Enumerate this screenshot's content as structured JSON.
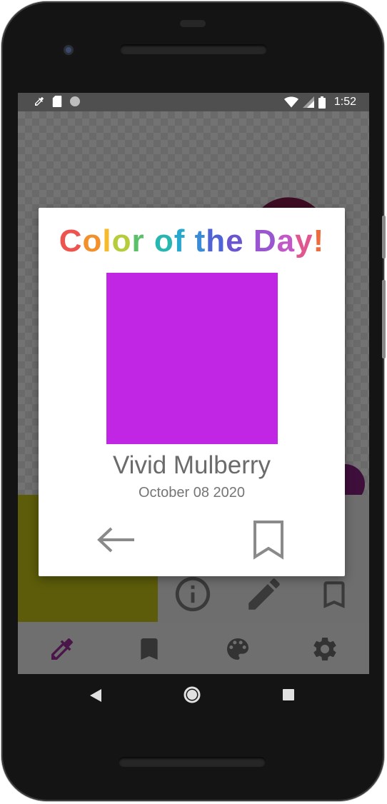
{
  "status_bar": {
    "time": "1:52",
    "left_icons": [
      "eyedropper-icon",
      "sd-card-icon",
      "circle-icon"
    ],
    "right_icons": [
      "wifi-icon",
      "signal-icon",
      "battery-icon"
    ]
  },
  "dialog": {
    "title_letters": [
      "C",
      "o",
      "l",
      "o",
      "r",
      " ",
      "o",
      "f",
      " ",
      "t",
      "h",
      "e",
      " ",
      "D",
      "a",
      "y",
      "!"
    ],
    "title_colors": [
      "#ef5350",
      "#f2902c",
      "#f6bb2c",
      "#b7cc3a",
      "#5cbf6a",
      "#ffffff",
      "#28b7b0",
      "#27a8cf",
      "#ffffff",
      "#3a8bd8",
      "#4d63d6",
      "#6b55cf",
      "#ffffff",
      "#9a55d0",
      "#c257c8",
      "#e0568f",
      "#ef6b3b"
    ],
    "swatch_color": "#c026e3",
    "color_name": "Vivid Mulberry",
    "date": "October 08 2020",
    "back_icon": "arrow-left-icon",
    "bookmark_icon": "bookmark-outline-icon"
  },
  "background_app": {
    "tools": [
      "info-icon",
      "pencil-icon",
      "bookmark-outline-icon"
    ],
    "bottom_nav": [
      "eyedropper-icon",
      "bookmark-icon",
      "palette-icon",
      "gear-icon"
    ],
    "active_accent": "#4a1548"
  },
  "system_nav": [
    "back-triangle-icon",
    "home-circle-icon",
    "recents-square-icon"
  ]
}
